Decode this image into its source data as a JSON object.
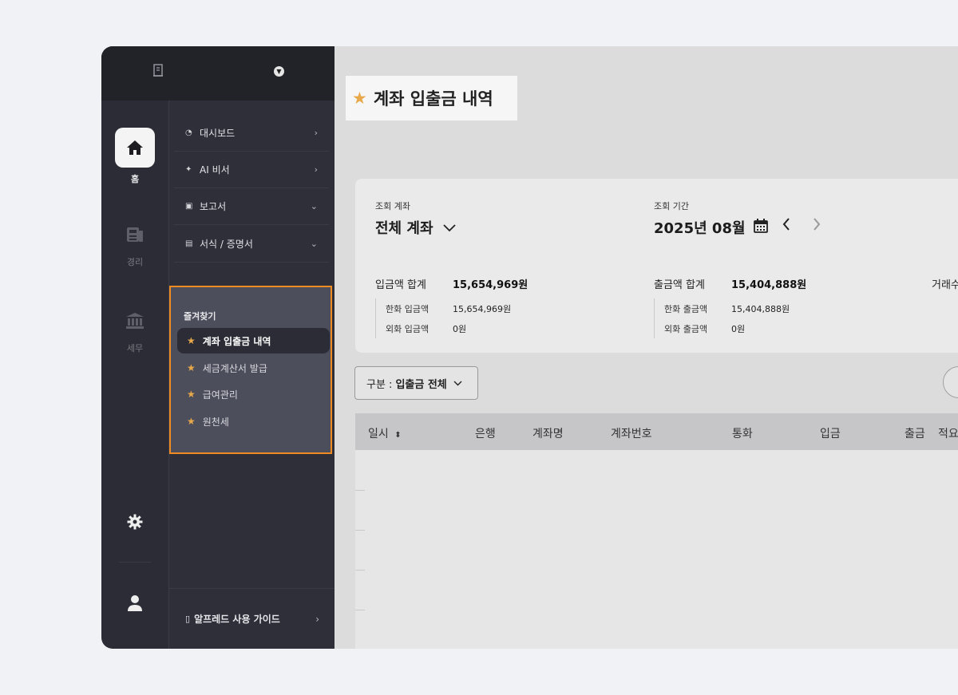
{
  "rail": {
    "items": [
      {
        "label": "홈"
      },
      {
        "label": "경리"
      },
      {
        "label": "세무"
      }
    ]
  },
  "menu": {
    "items": [
      {
        "label": "대시보드",
        "icon": "pie-icon",
        "arrow": "›"
      },
      {
        "label": "AI 비서",
        "icon": "sparkle-icon",
        "arrow": "›"
      },
      {
        "label": "보고서",
        "icon": "report-icon",
        "arrow": "⌄"
      },
      {
        "label": "서식 / 증명서",
        "icon": "doc-icon",
        "arrow": "⌄"
      }
    ],
    "favorites_title": "즐겨찾기",
    "favorites": [
      {
        "label": "계좌 입출금 내역",
        "active": true
      },
      {
        "label": "세금계산서 발급"
      },
      {
        "label": "급여관리"
      },
      {
        "label": "원천세"
      }
    ],
    "guide_label": "알프레드 사용 가이드",
    "guide_arrow": "›"
  },
  "page": {
    "title": "계좌 입출금 내역"
  },
  "summary": {
    "account_label": "조회 계좌",
    "account_value": "전체 계좌",
    "period_label": "조회 기간",
    "period_value": "2025년 08월",
    "deposit_total_label": "입금액 합계",
    "deposit_total_value": "15,654,969원",
    "deposit_krw_label": "한화 입금액",
    "deposit_krw_value": "15,654,969원",
    "deposit_fx_label": "외화 입금액",
    "deposit_fx_value": "0원",
    "withdraw_total_label": "출금액 합계",
    "withdraw_total_value": "15,404,888원",
    "withdraw_krw_label": "한화 출금액",
    "withdraw_krw_value": "15,404,888원",
    "withdraw_fx_label": "외화 출금액",
    "withdraw_fx_value": "0원",
    "tx_count_label": "거래수"
  },
  "filter": {
    "prefix": "구분 :",
    "value": "입출금 전체"
  },
  "table": {
    "columns": [
      "일시",
      "은행",
      "계좌명",
      "계좌번호",
      "통화",
      "입금",
      "출금",
      "적요"
    ]
  }
}
